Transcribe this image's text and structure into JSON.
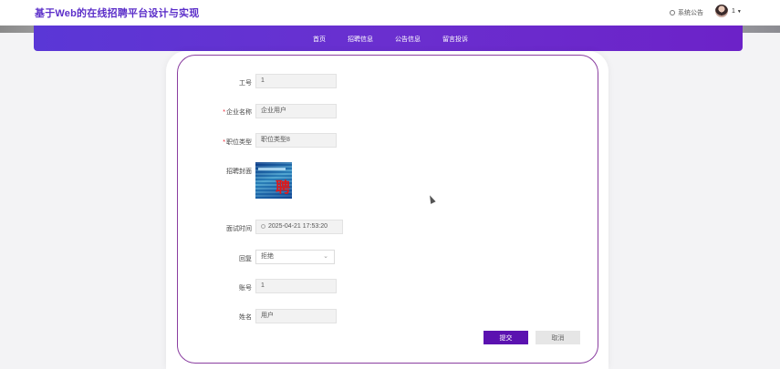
{
  "header": {
    "site_title": "基于Web的在线招聘平台设计与实现",
    "notice_label": "系统公告",
    "user_name": "1",
    "user_caret": "▼"
  },
  "nav": {
    "items": [
      "首页",
      "招聘信息",
      "公告信息",
      "留言投诉"
    ]
  },
  "form": {
    "job_id": {
      "label": "工号",
      "value": "1",
      "required": false
    },
    "company_name": {
      "label": "企业名称",
      "value": "企业用户",
      "required": true
    },
    "position_type": {
      "label": "职位类型",
      "value": "职位类型8",
      "required": true
    },
    "recruit_cover": {
      "label": "招聘封面",
      "image_text": "聘"
    },
    "interview_time": {
      "label": "面试时间",
      "value": "2025-04-21 17:53:20"
    },
    "reply": {
      "label": "回复",
      "value": "拒绝"
    },
    "account": {
      "label": "账号",
      "value": "1"
    },
    "name": {
      "label": "姓名",
      "value": "用户"
    },
    "required_mark": "*"
  },
  "buttons": {
    "submit": "提交",
    "cancel": "取消"
  },
  "colors": {
    "brand": "#5b2ec9",
    "nav_bg": "#6a2fcf",
    "submit_bg": "#5b12b0",
    "card_border": "#8a3ea0"
  }
}
